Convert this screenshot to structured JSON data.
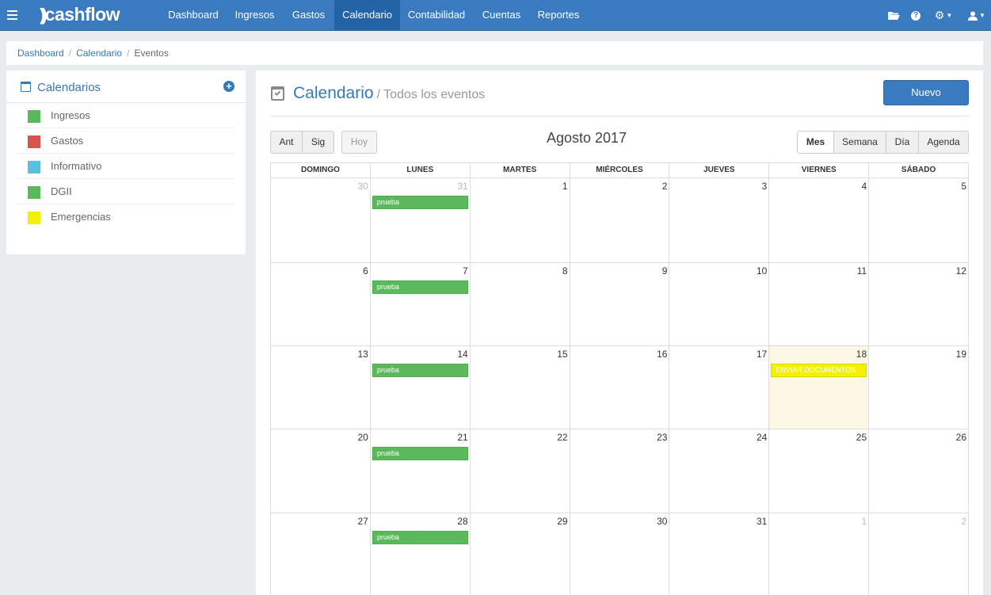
{
  "app": {
    "logo_text": "cashflow",
    "logo_mark": "))"
  },
  "nav": {
    "items": [
      {
        "label": "Dashboard"
      },
      {
        "label": "Ingresos"
      },
      {
        "label": "Gastos"
      },
      {
        "label": "Calendario",
        "active": true
      },
      {
        "label": "Contabilidad"
      },
      {
        "label": "Cuentas"
      },
      {
        "label": "Reportes"
      }
    ],
    "help_glyph": "?",
    "caret_glyph": "▼"
  },
  "breadcrumb": {
    "items": [
      "Dashboard",
      "Calendario"
    ],
    "current": "Eventos",
    "separator": "/"
  },
  "sidebar": {
    "title": "Calendarios",
    "add_glyph": "+",
    "calendars": [
      {
        "label": "Ingresos",
        "color": "#5cb85c"
      },
      {
        "label": "Gastos",
        "color": "#d9534f"
      },
      {
        "label": "Informativo",
        "color": "#5bc0de"
      },
      {
        "label": "DGII",
        "color": "#5cb85c"
      },
      {
        "label": "Emergencias",
        "color": "#f2f200"
      }
    ]
  },
  "main": {
    "title": "Calendario",
    "subtitle": "/ Todos los eventos",
    "new_button": "Nuevo",
    "prev_button": "Ant",
    "next_button": "Sig",
    "today_button": "Hoy",
    "month_label": "Agosto 2017",
    "views": [
      "Mes",
      "Semana",
      "Día",
      "Agenda"
    ],
    "active_view": "Mes"
  },
  "calendar": {
    "weekdays": [
      "DOMINGO",
      "LUNES",
      "MARTES",
      "MIÉRCOLES",
      "JUEVES",
      "VIERNES",
      "SÁBADO"
    ],
    "weeks": [
      [
        {
          "day": "30",
          "other": true
        },
        {
          "day": "31",
          "other": true,
          "event": "prueba",
          "event_color": "#5cb85c"
        },
        {
          "day": "1"
        },
        {
          "day": "2"
        },
        {
          "day": "3"
        },
        {
          "day": "4"
        },
        {
          "day": "5"
        }
      ],
      [
        {
          "day": "6"
        },
        {
          "day": "7",
          "event": "prueba",
          "event_color": "#5cb85c"
        },
        {
          "day": "8"
        },
        {
          "day": "9"
        },
        {
          "day": "10"
        },
        {
          "day": "11"
        },
        {
          "day": "12"
        }
      ],
      [
        {
          "day": "13"
        },
        {
          "day": "14",
          "event": "prueba",
          "event_color": "#5cb85c"
        },
        {
          "day": "15"
        },
        {
          "day": "16"
        },
        {
          "day": "17"
        },
        {
          "day": "18",
          "today": true,
          "event": "ENVIAR DOCUMENTOS",
          "event_color": "#f2f200"
        },
        {
          "day": "19"
        }
      ],
      [
        {
          "day": "20"
        },
        {
          "day": "21",
          "event": "prueba",
          "event_color": "#5cb85c"
        },
        {
          "day": "22"
        },
        {
          "day": "23"
        },
        {
          "day": "24"
        },
        {
          "day": "25"
        },
        {
          "day": "26"
        }
      ],
      [
        {
          "day": "27"
        },
        {
          "day": "28",
          "event": "prueba",
          "event_color": "#5cb85c"
        },
        {
          "day": "29"
        },
        {
          "day": "30"
        },
        {
          "day": "31"
        },
        {
          "day": "1",
          "other": true
        },
        {
          "day": "2",
          "other": true
        }
      ]
    ]
  }
}
